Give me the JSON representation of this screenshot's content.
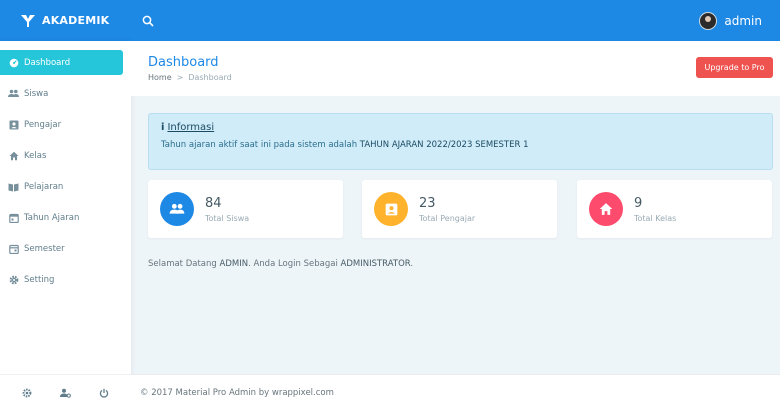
{
  "brand": {
    "name": "AKADEMIK"
  },
  "topbar": {
    "user_name": "admin"
  },
  "sidebar": {
    "items": [
      {
        "label": "Dashboard",
        "icon": "dashboard-icon"
      },
      {
        "label": "Siswa",
        "icon": "people-icon"
      },
      {
        "label": "Pengajar",
        "icon": "badge-icon"
      },
      {
        "label": "Kelas",
        "icon": "home-icon"
      },
      {
        "label": "Pelajaran",
        "icon": "book-icon"
      },
      {
        "label": "Tahun Ajaran",
        "icon": "calendar-icon"
      },
      {
        "label": "Semester",
        "icon": "event-icon"
      },
      {
        "label": "Setting",
        "icon": "gear-icon"
      }
    ],
    "footer_icons": [
      "settings-icon",
      "manage-users-icon",
      "power-icon"
    ]
  },
  "page": {
    "title": "Dashboard",
    "breadcrumb": {
      "home": "Home",
      "separator": ">",
      "current": "Dashboard"
    },
    "upgrade_label": "Upgrade to Pro"
  },
  "info": {
    "title_icon": "i",
    "title": "Informasi",
    "text_prefix": "Tahun ajaran aktif saat ini pada sistem adalah",
    "text_strong": "TAHUN AJARAN 2022/2023 SEMESTER 1"
  },
  "stats": [
    {
      "value": "84",
      "label": "Total Siswa",
      "color": "#1e88e5",
      "icon": "people-icon"
    },
    {
      "value": "23",
      "label": "Total Pengajar",
      "color": "#ffb22b",
      "icon": "badge-icon"
    },
    {
      "value": "9",
      "label": "Total Kelas",
      "color": "#fc4b6c",
      "icon": "home-icon"
    }
  ],
  "welcome": {
    "prefix": "Selamat Datang",
    "name": "ADMIN",
    "middle": ". Anda Login Sebagai",
    "role": "ADMINISTRATOR",
    "suffix": "."
  },
  "footer": {
    "text": "© 2017 Material Pro Admin by wrappixel.com"
  },
  "colors": {
    "primary": "#1e88e5",
    "active": "#26c6da",
    "danger": "#ef5350",
    "info_bg": "#cfecf8"
  }
}
